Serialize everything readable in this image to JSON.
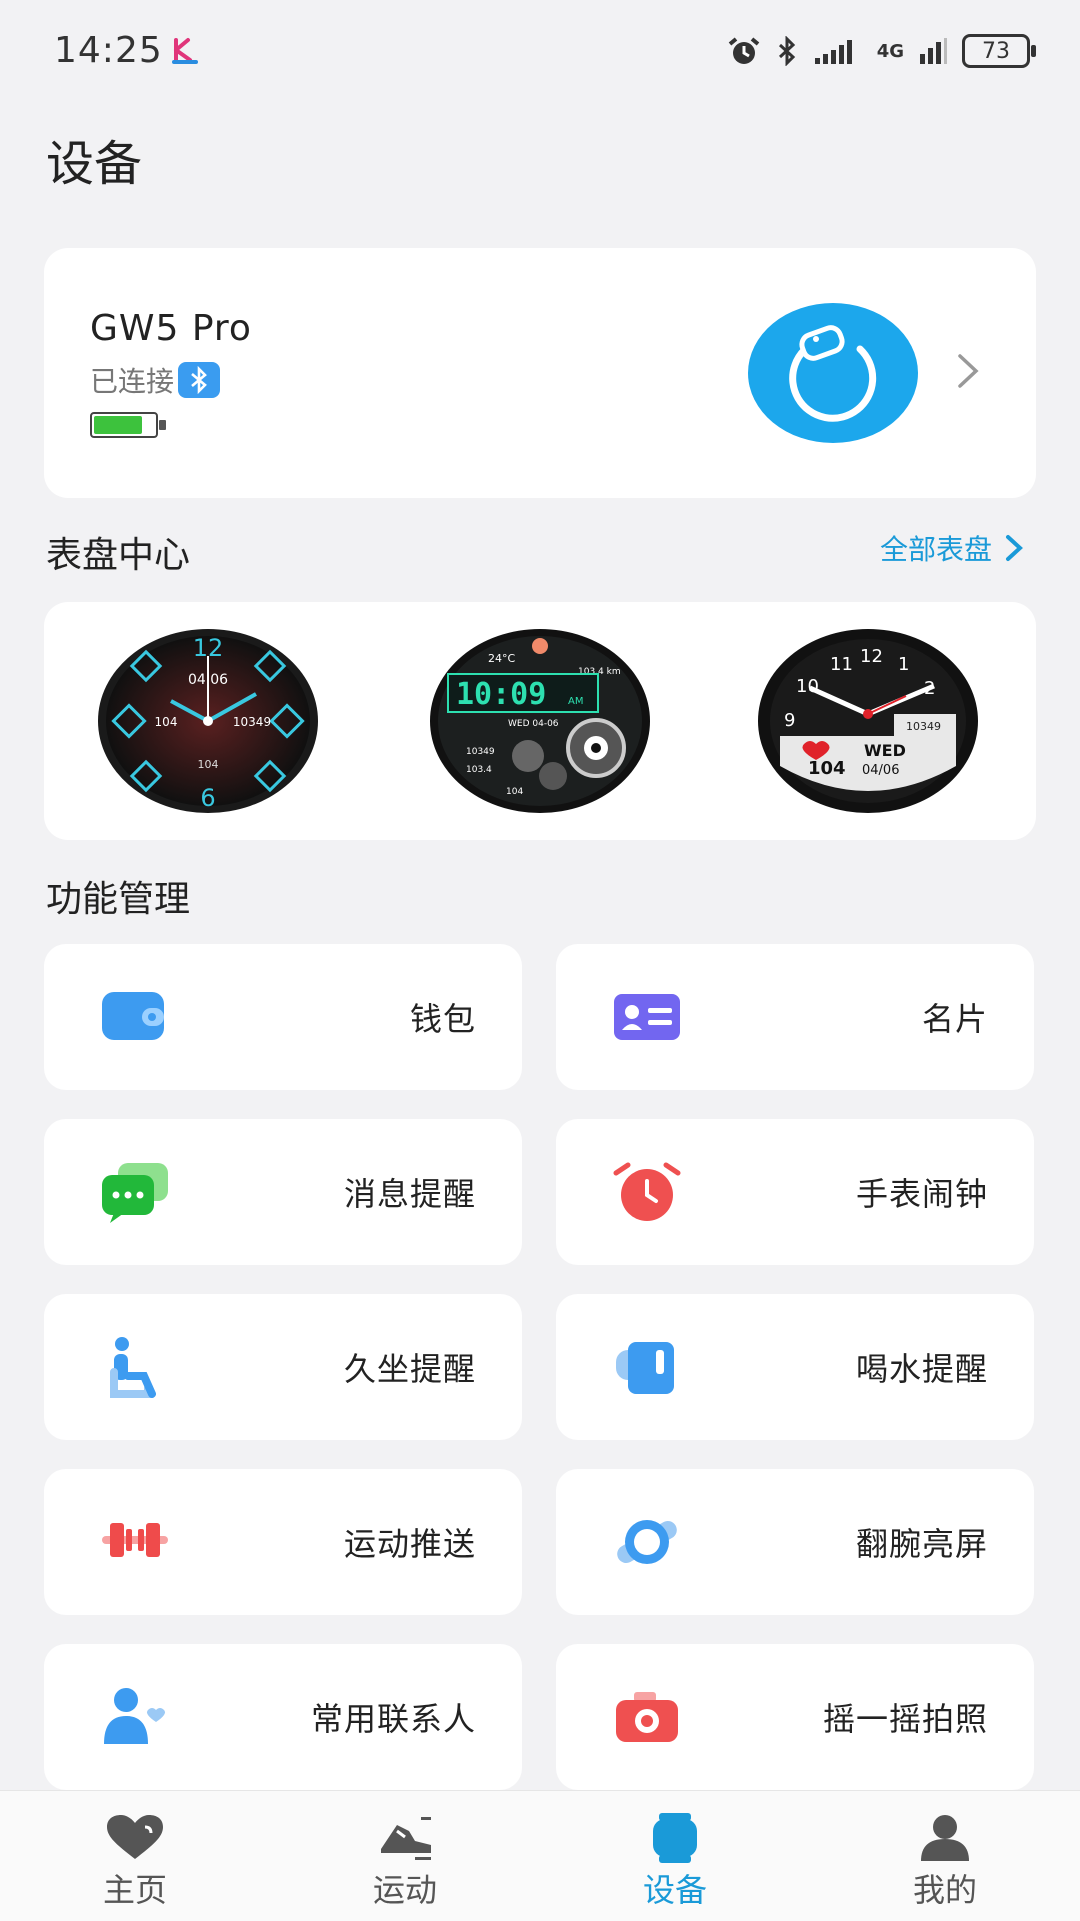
{
  "status_bar": {
    "time": "14:25",
    "network": "4G",
    "battery": "73"
  },
  "page": {
    "title": "设备"
  },
  "device": {
    "name": "GW5 Pro",
    "status": "已连接",
    "battery_level": 0.8,
    "accent": "#1ca7ec"
  },
  "watch_faces": {
    "title": "表盘中心",
    "view_all": "全部表盘",
    "faces": [
      {
        "date": "04.06",
        "top_number": "12",
        "bottom_number": "6",
        "left_value": "104",
        "right_value": "10349",
        "bottom_value": "104"
      },
      {
        "time": "10:09",
        "ampm": "AM",
        "temp": "24°C",
        "date": "WED 04-06",
        "dist": "103.4 km",
        "steps": "10349",
        "kcal": "103.4",
        "heart": "104"
      },
      {
        "steps": "10349",
        "day": "WED",
        "date": "04/06",
        "heart": "104",
        "numbers": [
          "11",
          "12",
          "1",
          "2",
          "10",
          "9"
        ]
      }
    ]
  },
  "features": {
    "title": "功能管理",
    "items": [
      {
        "label": "钱包",
        "icon": "wallet-icon"
      },
      {
        "label": "名片",
        "icon": "business-card-icon"
      },
      {
        "label": "消息提醒",
        "icon": "message-icon"
      },
      {
        "label": "手表闹钟",
        "icon": "alarm-clock-icon"
      },
      {
        "label": "久坐提醒",
        "icon": "sedentary-icon"
      },
      {
        "label": "喝水提醒",
        "icon": "cup-icon"
      },
      {
        "label": "运动推送",
        "icon": "dumbbell-icon"
      },
      {
        "label": "翻腕亮屏",
        "icon": "watch-icon"
      },
      {
        "label": "常用联系人",
        "icon": "contact-icon"
      },
      {
        "label": "摇一摇拍照",
        "icon": "camera-icon"
      }
    ]
  },
  "nav": {
    "items": [
      {
        "label": "主页",
        "icon": "heart-icon"
      },
      {
        "label": "运动",
        "icon": "shoe-icon"
      },
      {
        "label": "设备",
        "icon": "device-icon",
        "active": true
      },
      {
        "label": "我的",
        "icon": "user-icon"
      }
    ],
    "active_color": "#1a9ad8"
  }
}
